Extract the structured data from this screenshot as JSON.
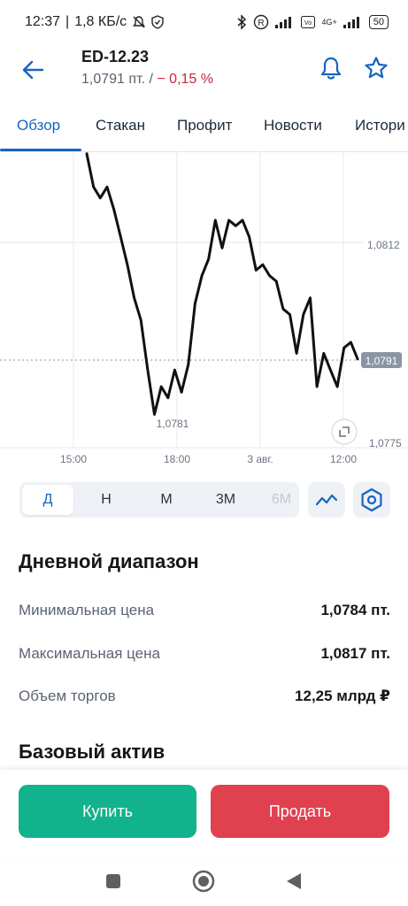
{
  "status_bar": {
    "time": "12:37",
    "separator": "|",
    "speed": "1,8 КБ/с",
    "network": "4G+",
    "battery": "50"
  },
  "header": {
    "ticker": "ED-12.23",
    "price": "1,0791 пт. / ",
    "change": "− 0,15 %"
  },
  "tabs": [
    "Обзор",
    "Стакан",
    "Профит",
    "Новости",
    "Истори"
  ],
  "chart_data": {
    "type": "line",
    "x_ticks": [
      "15:00",
      "18:00",
      "3 авг.",
      "12:00"
    ],
    "y_ticks": [
      "1,0812",
      "1,0775"
    ],
    "y_range": [
      1.0775,
      1.0812
    ],
    "current_label": "1,0791",
    "min_label": "1,0781",
    "series": [
      {
        "values": [
          1.0828,
          1.0822,
          1.082,
          1.0822,
          1.0818,
          1.0813,
          1.0808,
          1.0802,
          1.0798,
          1.0789,
          1.0781,
          1.0786,
          1.0784,
          1.0789,
          1.0785,
          1.079,
          1.0801,
          1.0806,
          1.0809,
          1.0816,
          1.0811,
          1.0816,
          1.0815,
          1.0816,
          1.0813,
          1.0807,
          1.0808,
          1.0806,
          1.0805,
          1.08,
          1.0799,
          1.0792,
          1.0799,
          1.0802,
          1.0786,
          1.0792,
          1.0789,
          1.0786,
          1.0793,
          1.0794,
          1.0791
        ]
      }
    ]
  },
  "periods": [
    "Д",
    "Н",
    "М",
    "3М",
    "6М"
  ],
  "active_period": "Д",
  "daily_range": {
    "title": "Дневной диапазон",
    "rows": [
      {
        "label": "Минимальная цена",
        "value": "1,0784 пт."
      },
      {
        "label": "Максимальная цена",
        "value": "1,0817 пт."
      },
      {
        "label": "Объем торгов",
        "value": "12,25 млрд ₽"
      }
    ]
  },
  "underlying": {
    "title": "Базовый актив"
  },
  "actions": {
    "buy": "Купить",
    "sell": "Продать"
  },
  "colors": {
    "accent": "#1565c0",
    "buy": "#12b28c",
    "sell": "#e0414f",
    "negative": "#c8283b"
  }
}
